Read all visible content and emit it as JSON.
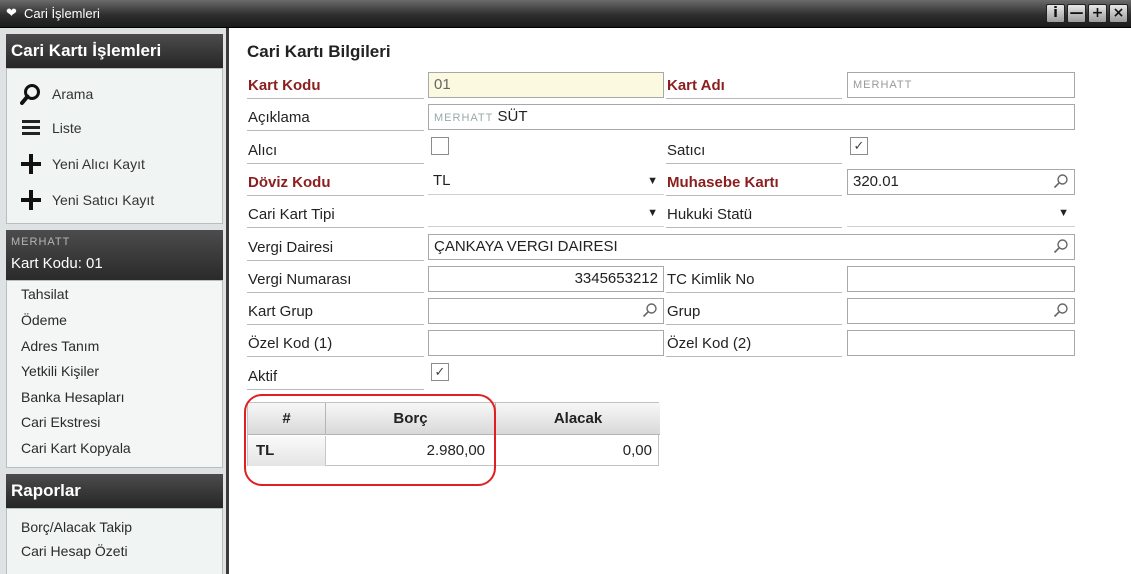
{
  "window": {
    "title": "Cari İşlemleri",
    "app_icon": "heart-wings-icon",
    "controls": [
      "i",
      "—",
      "+",
      "×"
    ]
  },
  "sidebar": {
    "panel_title": "Cari Kartı İşlemleri",
    "actions": [
      {
        "label": "Arama",
        "icon": "search-icon"
      },
      {
        "label": "Liste",
        "icon": "list-icon"
      },
      {
        "label": "Yeni Alıcı Kayıt",
        "icon": "add-icon"
      },
      {
        "label": "Yeni Satıcı Kayıt",
        "icon": "add-icon"
      }
    ],
    "card_header": {
      "name_blurred": "MERHATT",
      "code": "Kart Kodu: 01"
    },
    "links": [
      "Tahsilat",
      "Ödeme",
      "Adres Tanım",
      "Yetkili Kişiler",
      "Banka Hesapları",
      "Cari Ekstresi",
      "Cari Kart Kopyala"
    ],
    "reports_title": "Raporlar",
    "reports": [
      "Borç/Alacak Takip",
      "Cari Hesap Özeti"
    ]
  },
  "main": {
    "title": "Cari Kartı Bilgileri",
    "fields": {
      "kart_kodu": {
        "label": "Kart Kodu",
        "value": "01"
      },
      "kart_adi": {
        "label": "Kart Adı",
        "value": "MERHATT"
      },
      "aciklama": {
        "label": "Açıklama",
        "value_blur": "MERHATT",
        "value": "SÜT"
      },
      "alici": {
        "label": "Alıcı",
        "checked": ""
      },
      "satici": {
        "label": "Satıcı",
        "checked": "✓"
      },
      "doviz_kodu": {
        "label": "Döviz Kodu",
        "value": "TL"
      },
      "muhasebe_karti": {
        "label": "Muhasebe Kartı",
        "value": "320.01"
      },
      "cari_kart_tipi": {
        "label": "Cari Kart Tipi",
        "value": ""
      },
      "hukuki_statu": {
        "label": "Hukuki Statü",
        "value": ""
      },
      "vergi_dairesi": {
        "label": "Vergi Dairesi",
        "value": "ÇANKAYA VERGI DAIRESI"
      },
      "vergi_numarasi": {
        "label": "Vergi Numarası",
        "value": "3345653212"
      },
      "tc_kimlik_no": {
        "label": "TC Kimlik No",
        "value": ""
      },
      "kart_grup": {
        "label": "Kart Grup",
        "value": ""
      },
      "grup": {
        "label": "Grup",
        "value": ""
      },
      "ozel_kod_1": {
        "label": "Özel Kod (1)",
        "value": ""
      },
      "ozel_kod_2": {
        "label": "Özel Kod (2)",
        "value": ""
      },
      "aktif": {
        "label": "Aktif",
        "checked": "✓"
      }
    },
    "balance_grid": {
      "columns": [
        "#",
        "Borç",
        "Alacak"
      ],
      "rows": [
        {
          "currency": "TL",
          "borc": "2.980,00",
          "alacak": "0,00"
        }
      ]
    }
  },
  "colors": {
    "required_label": "#8b1e1e",
    "titlebar": "#2e2e2e",
    "highlight": "#e02020",
    "key_field": "#fbf9df"
  }
}
